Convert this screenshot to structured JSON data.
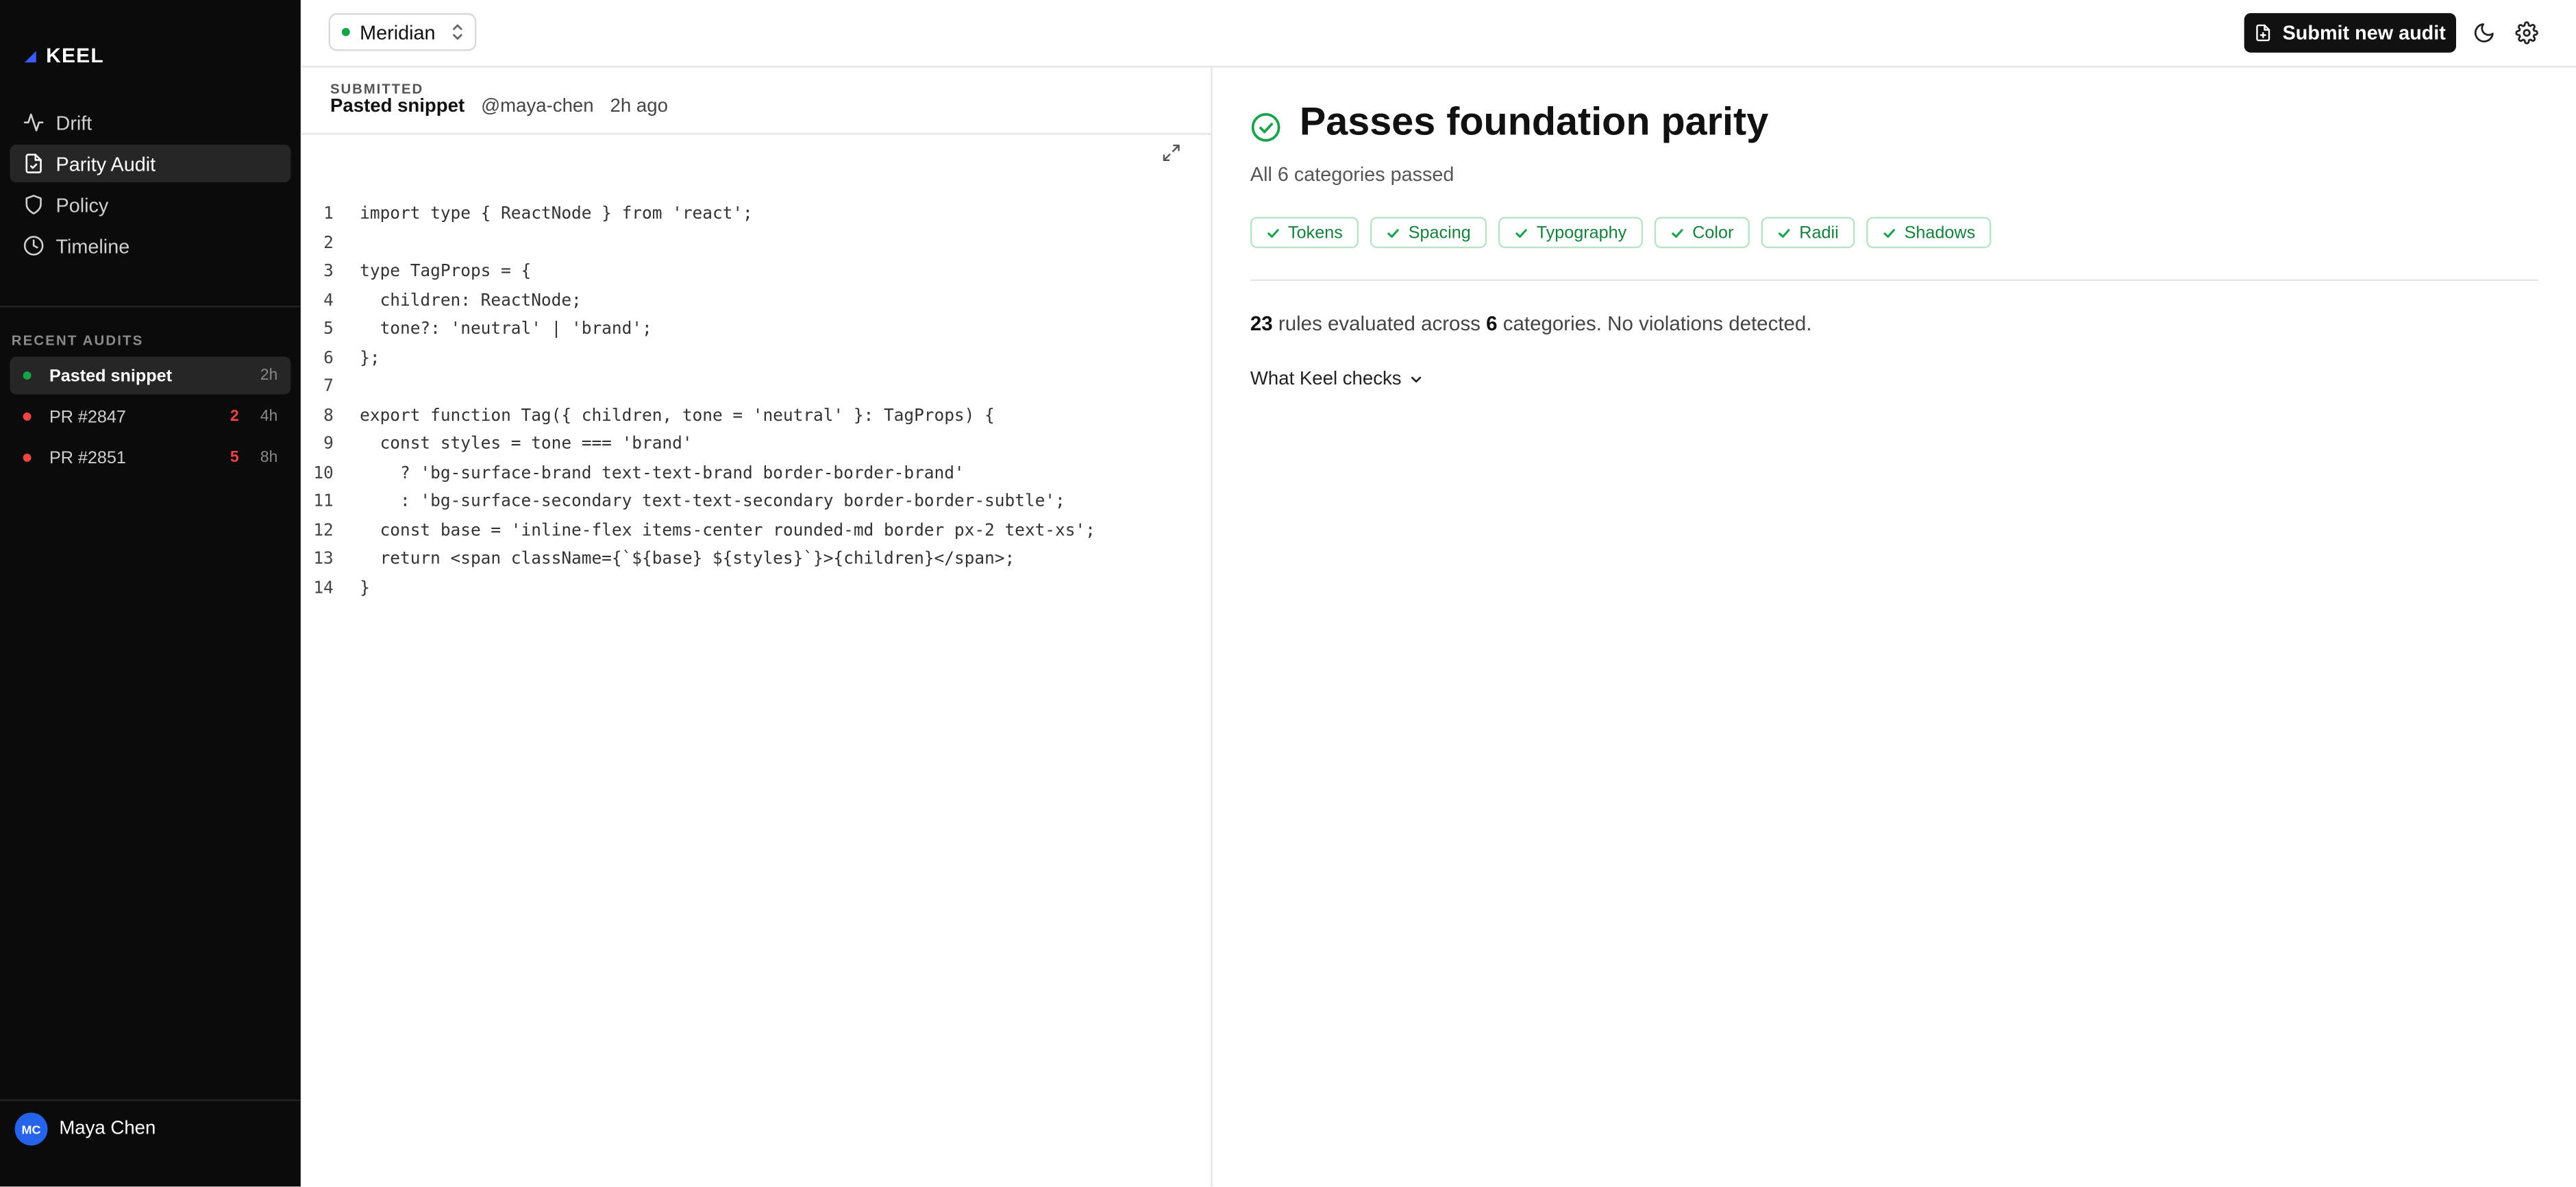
{
  "app": {
    "brand": "KEEL",
    "brand_color": "#3b5bff"
  },
  "sidebar": {
    "nav": [
      {
        "label": "Drift",
        "icon": "activity-icon",
        "active": false
      },
      {
        "label": "Parity Audit",
        "icon": "file-check-icon",
        "active": true
      },
      {
        "label": "Policy",
        "icon": "shield-icon",
        "active": false
      },
      {
        "label": "Timeline",
        "icon": "clock-icon",
        "active": false
      }
    ],
    "recent_label": "RECENT AUDITS",
    "recent": [
      {
        "label": "Pasted snippet",
        "count": "",
        "age": "2h",
        "status_color": "#16a34a",
        "active": true
      },
      {
        "label": "PR #2847",
        "count": "2",
        "age": "4h",
        "status_color": "#ef4444",
        "active": false
      },
      {
        "label": "PR #2851",
        "count": "5",
        "age": "8h",
        "status_color": "#ef4444",
        "active": false
      }
    ],
    "user": {
      "initials": "MC",
      "name": "Maya Chen"
    }
  },
  "topbar": {
    "project": "Meridian",
    "submit_label": "Submit new audit"
  },
  "submission": {
    "label": "SUBMITTED",
    "title": "Pasted snippet",
    "author": "@maya-chen",
    "time": "2h ago"
  },
  "code": [
    "import type { ReactNode } from 'react';",
    "",
    "type TagProps = {",
    "  children: ReactNode;",
    "  tone?: 'neutral' | 'brand';",
    "};",
    "",
    "export function Tag({ children, tone = 'neutral' }: TagProps) {",
    "  const styles = tone === 'brand'",
    "    ? 'bg-surface-brand text-text-brand border-border-brand'",
    "    : 'bg-surface-secondary text-text-secondary border-border-subtle';",
    "  const base = 'inline-flex items-center rounded-md border px-2 text-xs';",
    "  return <span className={`${base} ${styles}`}>{children}</span>;",
    "}"
  ],
  "result": {
    "title": "Passes foundation parity",
    "subtitle": "All 6 categories passed",
    "categories": [
      "Tokens",
      "Spacing",
      "Typography",
      "Color",
      "Radii",
      "Shadows"
    ],
    "rules_count": "23",
    "summary_mid": " rules evaluated across ",
    "category_count": "6",
    "summary_tail": " categories. No violations detected.",
    "checks_label": "What Keel checks",
    "pass_color": "#16a34a"
  }
}
